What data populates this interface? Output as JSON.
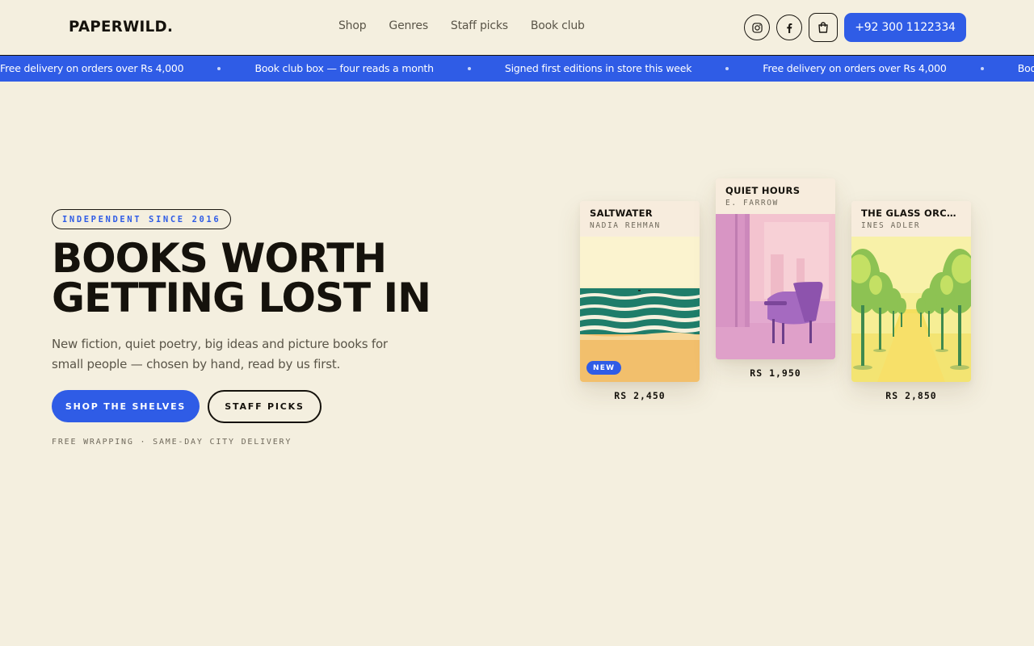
{
  "header": {
    "logo": "PAPERWILD.",
    "nav": [
      "Shop",
      "Genres",
      "Staff picks",
      "Book club"
    ],
    "phone": "+92 300 1122334",
    "icons": [
      "instagram-icon",
      "facebook-icon",
      "shopping-bag-icon"
    ]
  },
  "ticker": {
    "items": [
      "Free delivery on orders over Rs 4,000",
      "Book club box — four reads a month",
      "Signed first editions in store this week",
      "Free delivery on orders over Rs 4,000",
      "Book club box — four reads a month"
    ]
  },
  "hero": {
    "eyebrow": "INDEPENDENT SINCE 2016",
    "headline_line1": "BOOKS WORTH",
    "headline_line2": "GETTING LOST IN",
    "subtitle": "New fiction, quiet poetry, big ideas and picture books for small people — chosen by hand, read by us first.",
    "primary_cta": "SHOP THE SHELVES",
    "secondary_cta": "STAFF PICKS",
    "footnote": "FREE WRAPPING · SAME-DAY CITY DELIVERY"
  },
  "books": [
    {
      "title": "SALTWATER",
      "author": "NADIA REHMAN",
      "price": "RS 2,450",
      "badge": "NEW"
    },
    {
      "title": "QUIET HOURS",
      "author": "E. FARROW",
      "price": "RS 1,950"
    },
    {
      "title": "THE GLASS ORCHARD",
      "author": "INES ADLER",
      "price": "RS 2,850"
    }
  ],
  "colors": {
    "background": "#f4efdf",
    "accent": "#2f5ce6",
    "ink": "#15120c"
  }
}
